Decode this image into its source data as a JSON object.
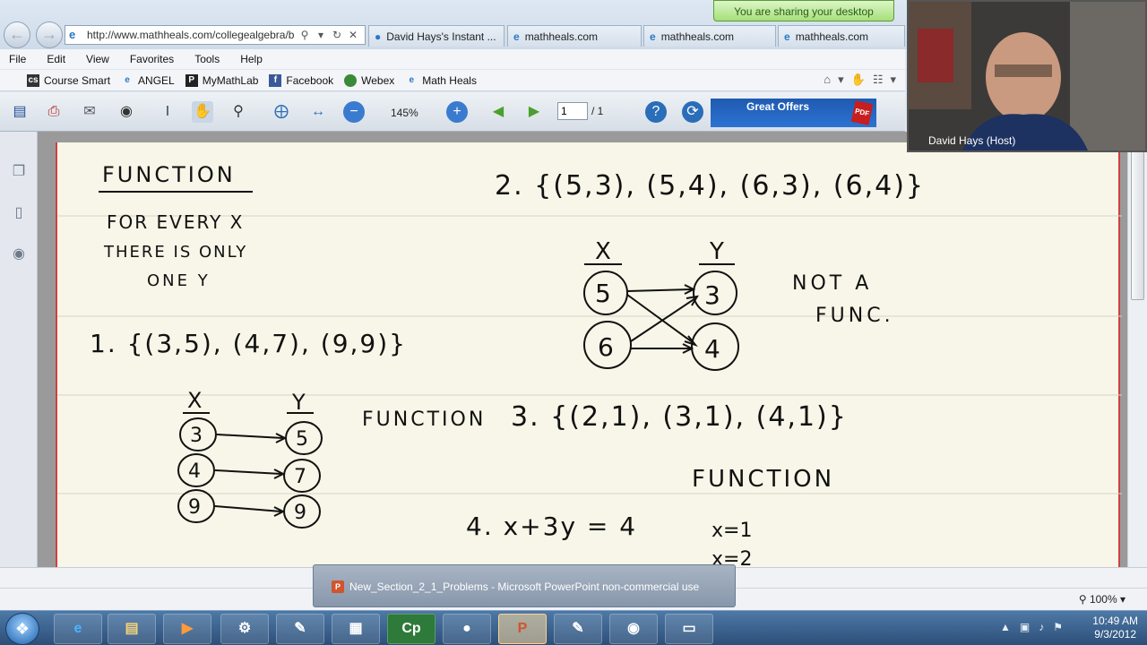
{
  "browser": {
    "address": "http://www.mathheals.com/collegealgebra/b",
    "tabs": [
      "David Hays's Instant ...",
      "mathheals.com",
      "mathheals.com",
      "mathheals.com"
    ],
    "menu": [
      "File",
      "Edit",
      "View",
      "Favorites",
      "Tools",
      "Help"
    ],
    "favorites": [
      {
        "label": "Course Smart",
        "icon": "cs-icon"
      },
      {
        "label": "ANGEL",
        "icon": "ie-page-icon"
      },
      {
        "label": "MyMathLab",
        "icon": "p-icon"
      },
      {
        "label": "Facebook",
        "icon": "facebook-icon"
      },
      {
        "label": "Webex",
        "icon": "webex-icon"
      },
      {
        "label": "Math Heals",
        "icon": "ie-page-icon"
      }
    ]
  },
  "pdf": {
    "zoom": "145%",
    "page": "1",
    "page_total": "/ 1",
    "offers": "Great Offers"
  },
  "sharing": {
    "banner": "You are sharing your desktop",
    "host": "David Hays (Host)"
  },
  "notes": {
    "heading": "FUNCTION",
    "definition": [
      "FOR EVERY X",
      "THERE IS ONLY",
      "ONE Y"
    ],
    "problem1": "1. {(3,5), (4,7), (9,9)}",
    "problem1_x": [
      "3",
      "4",
      "9"
    ],
    "problem1_y": [
      "5",
      "7",
      "9"
    ],
    "problem1_answer": "FUNCTION",
    "problem2": "2. {(5,3), (5,4), (6,3), (6,4)}",
    "problem2_x": [
      "5",
      "6"
    ],
    "problem2_y": [
      "3",
      "4"
    ],
    "problem2_answer": [
      "NOT A",
      "FUNC."
    ],
    "problem3": "3. {(2,1), (3,1), (4,1)}",
    "problem3_answer": "FUNCTION",
    "problem4": "4. x+3y = 4",
    "problem4_work": [
      "x=1",
      "x=2"
    ],
    "axis_x": "X",
    "axis_y": "Y"
  },
  "status": {
    "zoom": "100%",
    "popup": "New_Section_2_1_Problems - Microsoft PowerPoint non-commercial use"
  },
  "taskbar": {
    "time": "10:49 AM",
    "date": "9/3/2012"
  }
}
